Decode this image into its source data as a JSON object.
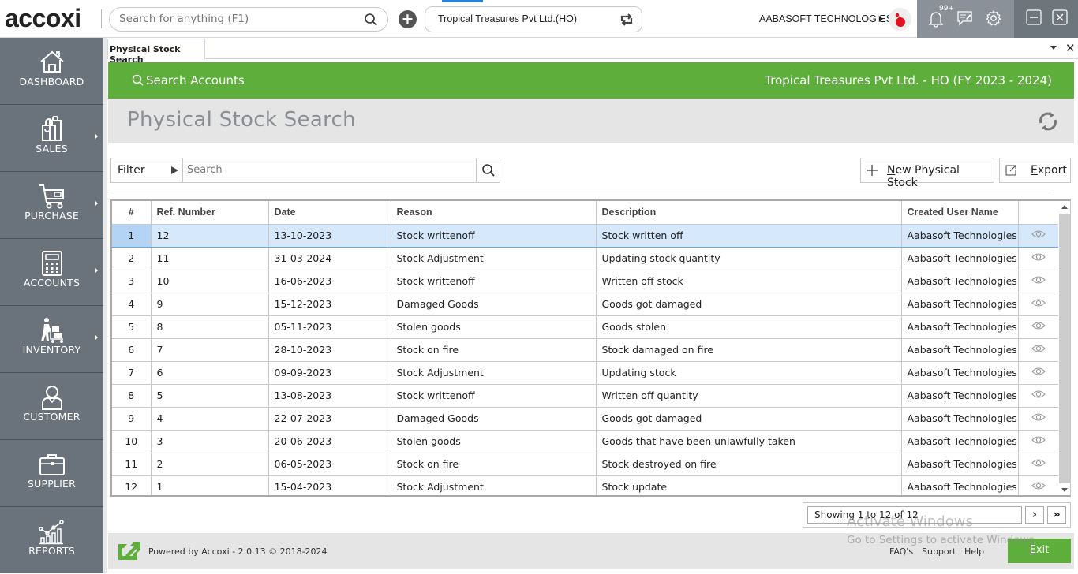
{
  "app": {
    "logo": "accoxi",
    "global_search_placeholder": "Search for anything (F1)",
    "company_selector": "Tropical Treasures Pvt Ltd.(HO)",
    "org_name": "AABASOFT TECHNOLOGIES",
    "notification_badge": "99+"
  },
  "sidebar": {
    "items": [
      {
        "label": "DASHBOARD",
        "icon": "home-icon",
        "has_submenu": false
      },
      {
        "label": "SALES",
        "icon": "shopping-bag-icon",
        "has_submenu": true
      },
      {
        "label": "PURCHASE",
        "icon": "cart-icon",
        "has_submenu": true
      },
      {
        "label": "ACCOUNTS",
        "icon": "calculator-icon",
        "has_submenu": true
      },
      {
        "label": "INVENTORY",
        "icon": "worker-trolley-icon",
        "has_submenu": true
      },
      {
        "label": "CUSTOMER",
        "icon": "user-icon",
        "has_submenu": false
      },
      {
        "label": "SUPPLIER",
        "icon": "briefcase-icon",
        "has_submenu": false
      },
      {
        "label": "REPORTS",
        "icon": "chart-icon",
        "has_submenu": false
      }
    ]
  },
  "doc_tab": {
    "label": "Physical Stock Search"
  },
  "header": {
    "search_accounts": "Search Accounts",
    "company_fy": "Tropical Treasures Pvt Ltd. - HO (FY 2023 - 2024)",
    "page_title": "Physical Stock Search"
  },
  "toolbar": {
    "filter_label": "Filter",
    "search_placeholder": "Search",
    "new_button": {
      "accel": "N",
      "rest": "ew Physical Stock"
    },
    "export_button": {
      "accel": "E",
      "rest": "xport"
    }
  },
  "table": {
    "columns": [
      "#",
      "Ref. Number",
      "Date",
      "Reason",
      "Description",
      "Created User Name",
      ""
    ],
    "selected_row": 0,
    "rows": [
      {
        "n": "1",
        "ref": "12",
        "date": "13-10-2023",
        "reason": "Stock writtenoff",
        "desc": "Stock written off",
        "user": "Aabasoft Technologies"
      },
      {
        "n": "2",
        "ref": "11",
        "date": "31-03-2024",
        "reason": "Stock Adjustment",
        "desc": "Updating stock quantity",
        "user": "Aabasoft Technologies"
      },
      {
        "n": "3",
        "ref": "10",
        "date": "16-06-2023",
        "reason": "Stock writtenoff",
        "desc": "Written off stock",
        "user": "Aabasoft Technologies"
      },
      {
        "n": "4",
        "ref": "9",
        "date": "15-12-2023",
        "reason": "Damaged Goods",
        "desc": "Goods got damaged",
        "user": "Aabasoft Technologies"
      },
      {
        "n": "5",
        "ref": "8",
        "date": "05-11-2023",
        "reason": "Stolen goods",
        "desc": "Goods stolen",
        "user": "Aabasoft Technologies"
      },
      {
        "n": "6",
        "ref": "7",
        "date": "28-10-2023",
        "reason": "Stock on fire",
        "desc": "Stock damaged on fire",
        "user": "Aabasoft Technologies"
      },
      {
        "n": "7",
        "ref": "6",
        "date": "09-09-2023",
        "reason": "Stock Adjustment",
        "desc": "Updating stock",
        "user": "Aabasoft Technologies"
      },
      {
        "n": "8",
        "ref": "5",
        "date": "13-08-2023",
        "reason": "Stock writtenoff",
        "desc": "Written off quantity",
        "user": "Aabasoft Technologies"
      },
      {
        "n": "9",
        "ref": "4",
        "date": "22-07-2023",
        "reason": "Damaged Goods",
        "desc": "Goods got damaged",
        "user": "Aabasoft Technologies"
      },
      {
        "n": "10",
        "ref": "3",
        "date": "20-06-2023",
        "reason": "Stolen goods",
        "desc": "Goods that have been unlawfully taken",
        "user": "Aabasoft Technologies"
      },
      {
        "n": "11",
        "ref": "2",
        "date": "06-05-2023",
        "reason": "Stock on fire",
        "desc": "Stock destroyed on fire",
        "user": "Aabasoft Technologies"
      },
      {
        "n": "12",
        "ref": "1",
        "date": "15-04-2023",
        "reason": "Stock Adjustment",
        "desc": "Stock update",
        "user": "Aabasoft Technologies"
      }
    ]
  },
  "pager": {
    "info": "Showing 1 to 12 of 12",
    "next": "›",
    "last": "»"
  },
  "footer": {
    "powered_by": "Powered by Accoxi - 2.0.13 © 2018-2024",
    "links": [
      "FAQ's",
      "Support",
      "Help"
    ],
    "exit_accel": "E",
    "exit_rest": "xit"
  },
  "watermark": {
    "line1": "Activate Windows",
    "line2": "Go to Settings to activate Windows."
  },
  "colors": {
    "brand_green": "#5dae3a",
    "sidebar": "#6a737b",
    "selected_row": "#d6e8fb"
  }
}
